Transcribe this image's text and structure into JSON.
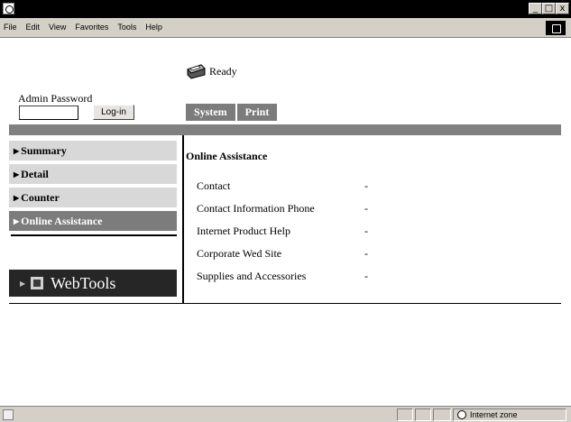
{
  "window": {
    "controls": [
      "_",
      "□",
      "x"
    ]
  },
  "menubar": {
    "items": [
      "File",
      "Edit",
      "View",
      "Favorites",
      "Tools",
      "Help"
    ]
  },
  "header": {
    "status": "Ready",
    "admin_label": "Admin Password",
    "password_value": "",
    "login_label": "Log-in",
    "tabs": [
      "System",
      "Print"
    ]
  },
  "nav": {
    "items": [
      "Summary",
      "Detail",
      "Counter",
      "Online Assistance"
    ],
    "active": "Online Assistance",
    "webtools_label": "WebTools"
  },
  "panel": {
    "title": "Online Assistance",
    "rows": [
      {
        "label": "Contact",
        "value": "-"
      },
      {
        "label": "Contact Information Phone",
        "value": "-"
      },
      {
        "label": "Internet Product Help",
        "value": "-"
      },
      {
        "label": "Corporate Wed Site",
        "value": "-"
      },
      {
        "label": "Supplies and Accessories",
        "value": "-"
      }
    ]
  },
  "statusbar": {
    "zone": "Internet zone"
  }
}
